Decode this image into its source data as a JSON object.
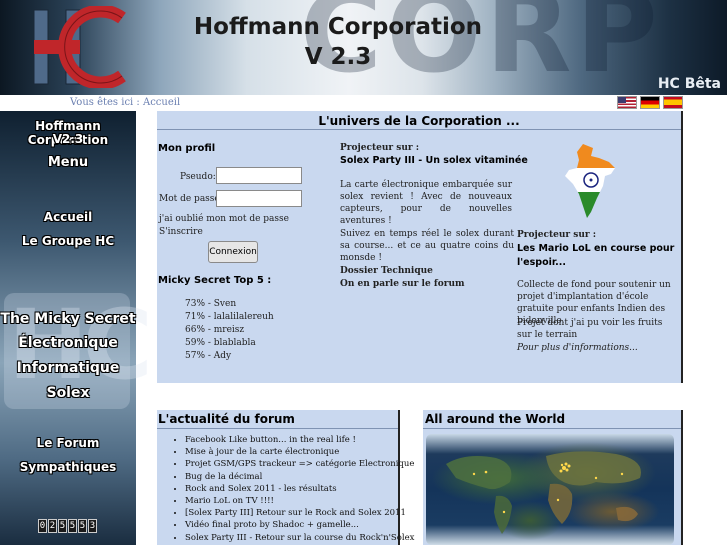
{
  "header": {
    "logo_text": "HC",
    "title_line1": "Hoffmann Corporation",
    "title_line2": "V 2.3",
    "watermark": "CORP",
    "edition": "HC Bêta"
  },
  "breadcrumb": {
    "prefix": "Vous êtes ici :",
    "current": "Accueil"
  },
  "flags": [
    {
      "icon": "us-flag-icon",
      "label": "English"
    },
    {
      "icon": "german-flag-icon",
      "label": "Deutsch"
    },
    {
      "icon": "spanish-flag-icon",
      "label": "Español"
    }
  ],
  "sidebar": {
    "title_line1": "Hoffmann Corporation",
    "title_line2": "V2.3",
    "menu_label": "Menu",
    "nav": {
      "home": "Accueil",
      "group": "Le Groupe HC",
      "micky": "The Micky Secret",
      "electronics": "Électronique",
      "computing": "Informatique",
      "solex": "Solex",
      "forum": "Le Forum",
      "friends": "Sympathiques"
    },
    "counter": [
      "0",
      "2",
      "5",
      "5",
      "5",
      "3"
    ]
  },
  "main": {
    "title": "L'univers de la Corporation ...",
    "profile": {
      "heading": "Mon profil",
      "pseudo_label": "Pseudo:",
      "password_label": "Mot de passe:",
      "forgot": "j'ai oublié mon mot de passe",
      "register": "S'inscrire",
      "login_button": "Connexion"
    },
    "top5": {
      "heading": "Micky Secret Top 5 :",
      "items": [
        "73% - Sven",
        "71% - lalalilalereuh",
        "66% - mreisz",
        "59% - blablabla",
        "57% - Ady"
      ]
    },
    "projector1": {
      "label": "Projecteur sur :",
      "title": "Solex Party III - Un solex vitaminée",
      "para1": "La carte électronique embarquée sur solex revient ! Avec de nouveaux capteurs, pour de nouvelles aventures !",
      "para2": "Suivez en temps réel le solex durant sa course... et ce au quatre coins du monsde !",
      "link1": "Dossier Technique",
      "link2": "On en parle sur le forum"
    },
    "projector2": {
      "label": "Projecteur sur :",
      "title": "Les Mario LoL en course pour l'espoir...",
      "para1": "Collecte de fond pour soutenir un projet d'implantation d'école gratuite pour enfants Indien des bidonville.",
      "para2": "Projet dont j'ai pu voir les fruits sur le terrain",
      "more": "Pour plus d'informations..."
    }
  },
  "forum": {
    "title": "L'actualité du forum",
    "items": [
      "Facebook Like button... in the real life !",
      "Mise à jour de la carte électronique",
      "Projet GSM/GPS trackeur => catégorie Electronique",
      "Bug de la décimal",
      "Rock and Solex 2011 - les résultats",
      "Mario LoL on TV !!!!",
      "[Solex Party III] Retour sur le Rock and Solex 2011",
      "Vidéo final proto by Shadoc + gamelle...",
      "Solex Party III - Retour sur la course du Rock'n'Solex"
    ]
  },
  "world": {
    "title": "All around the World"
  }
}
